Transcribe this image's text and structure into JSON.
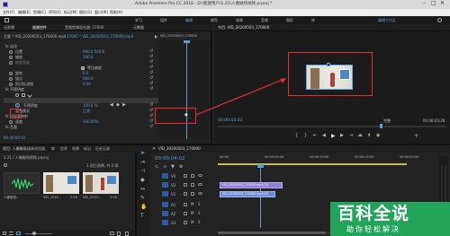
{
  "window": {
    "title": "Adobe Premiere Pro CC 2018 - D:\\新建用户\\1.21\\人像磁场视频.prproj *",
    "menu": [
      "文件(F)",
      "编辑(E)",
      "剪辑(C)",
      "序列(S)",
      "标记(M)",
      "图形(G)",
      "窗口(W)",
      "帮助(H)"
    ],
    "workspace_tabs": [
      "学习",
      "组件",
      "编辑",
      "颜色",
      "效果",
      "音频",
      "图形",
      "库"
    ],
    "workspace_menu": "编辑工作区"
  },
  "effect_controls": {
    "tabs": [
      "无剪辑",
      "效果控件",
      "音频剪辑混合器: 17000",
      "元数据"
    ],
    "source_label": "主要 * VID_20200503_170000.mp4",
    "clip_label": "17000 * VID_20200503_170000.mp4",
    "mini_clip": "VID_20200503_170000",
    "rows": [
      {
        "label": "fx 运动",
        "value": ""
      },
      {
        "label": "位置",
        "value": "960.0   540.0"
      },
      {
        "label": "缩放",
        "value": "100.0"
      },
      {
        "label": "缩放宽度",
        "value": ""
      },
      {
        "label": "",
        "value": "等比缩放"
      },
      {
        "label": "旋转",
        "value": "0.0"
      },
      {
        "label": "锚点",
        "value": "960.0"
      },
      {
        "label": "防闪烁滤镜",
        "value": "0.00"
      },
      {
        "label": "fx 不透明度",
        "value": ""
      },
      {
        "label": "",
        "value": ""
      },
      {
        "label": "不透明度",
        "value": "100.0 %"
      },
      {
        "label": "混合模式",
        "value": "正常"
      },
      {
        "label": "fx 时间重映射",
        "value": ""
      },
      {
        "label": "速度",
        "value": "100.00%"
      },
      {
        "label": "fx 音量",
        "value": ""
      }
    ],
    "timecode": "00:00:04:02"
  },
  "program_monitor": {
    "tab": "节目: VID_20200503_170000",
    "timecode_left": "00:00:04:02",
    "fit": "完整",
    "timecode_right": "00:00:03;28"
  },
  "project_panel": {
    "tabs": [
      "项目: 人像磁场",
      "媒体浏览器",
      "库",
      "信息",
      "效果",
      "标记",
      "历史记录"
    ],
    "file": "1.21 / 人像磁场视频.prproj",
    "count": "1 项已选择, 共 2 项",
    "items": [
      {
        "name": "VID_2020...",
        "duration": "3:26"
      },
      {
        "name": "VID_2020...",
        "duration": "3:28"
      }
    ],
    "sequence_label": "人像磁场..."
  },
  "timeline": {
    "tab": "VID_20200503_170000",
    "timecode": "00:00:04:02",
    "ruler": [
      "00:00",
      "00:00:05:00",
      "00:00:10:00",
      "00:00:15:00",
      "00:00:20:00"
    ],
    "tracks": [
      "V3",
      "V2",
      "V1",
      "A1",
      "A2",
      "A3"
    ],
    "clip_upper": "VID_20200503_170000.mp4 [V]",
    "clip_lower": "VID_20200503_170000.mp4 [V]"
  },
  "watermark": {
    "brand": "百科全说",
    "slogan": "助你轻松解决"
  },
  "colors": {
    "highlight": "#e03030",
    "accent": "#2d8ceb",
    "playhead": "#5c9cd8",
    "brand": "#22a55a"
  }
}
